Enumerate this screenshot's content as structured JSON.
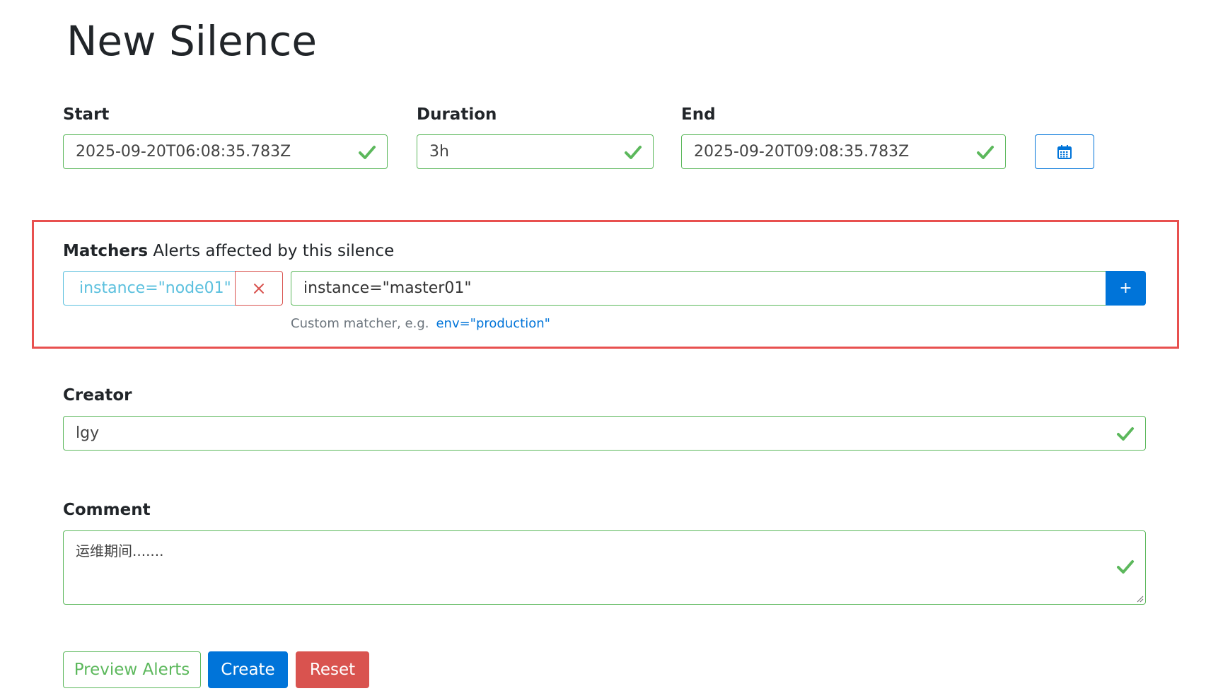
{
  "page": {
    "title": "New Silence"
  },
  "time": {
    "start": {
      "label": "Start",
      "value": "2025-09-20T06:08:35.783Z"
    },
    "duration": {
      "label": "Duration",
      "value": "3h"
    },
    "end": {
      "label": "End",
      "value": "2025-09-20T09:08:35.783Z"
    },
    "calendar_icon": "calendar-icon"
  },
  "matchers": {
    "title": "Matchers",
    "subtitle": "Alerts affected by this silence",
    "existing": [
      {
        "text": "instance=\"node01\"",
        "remove_icon": "close-icon"
      }
    ],
    "input_value": "instance=\"master01\"",
    "add_label": "+",
    "hint_text": "Custom matcher, e.g.",
    "hint_example": "env=\"production\""
  },
  "creator": {
    "label": "Creator",
    "value": "lgy"
  },
  "comment": {
    "label": "Comment",
    "value": "运维期间......."
  },
  "buttons": {
    "preview": "Preview Alerts",
    "create": "Create",
    "reset": "Reset"
  },
  "colors": {
    "success": "#5cb85c",
    "primary": "#0074d9",
    "danger": "#d9534f",
    "info": "#5bc0de",
    "highlight": "#e8504f"
  },
  "icons": {
    "valid": "check-icon",
    "resize": "resize-grip-icon"
  }
}
